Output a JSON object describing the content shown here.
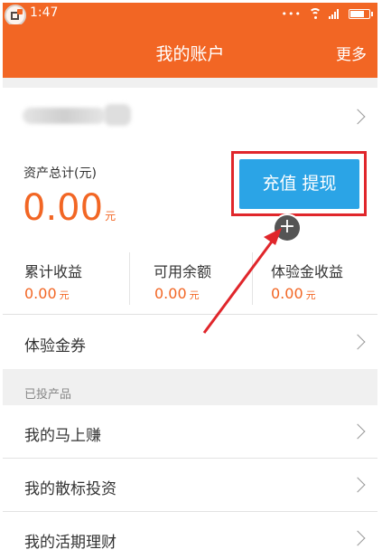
{
  "status_bar": {
    "time": "1:47",
    "dots": "•••"
  },
  "nav": {
    "title": "我的账户",
    "more": "更多"
  },
  "assets": {
    "label": "资产总计(元)",
    "amount": "0.00",
    "unit": "元",
    "charge_withdraw_label": "充值 提现"
  },
  "stats": [
    {
      "label": "累计收益",
      "value": "0.00",
      "unit": "元"
    },
    {
      "label": "可用余额",
      "value": "0.00",
      "unit": "元"
    },
    {
      "label": "体验金收益",
      "value": "0.00",
      "unit": "元"
    }
  ],
  "voucher": {
    "label": "体验金券"
  },
  "section": {
    "label": "已投产品"
  },
  "products": [
    {
      "label": "我的马上赚"
    },
    {
      "label": "我的散标投资"
    },
    {
      "label": "我的活期理财"
    }
  ],
  "colors": {
    "accent": "#f26624",
    "button": "#2ba4e6",
    "highlight": "#e0262b"
  },
  "icons": [
    "app-switch-icon",
    "wifi-icon",
    "signal-icon",
    "battery-icon",
    "chevron-right-icon",
    "plus-icon",
    "annotation-arrow-icon"
  ]
}
